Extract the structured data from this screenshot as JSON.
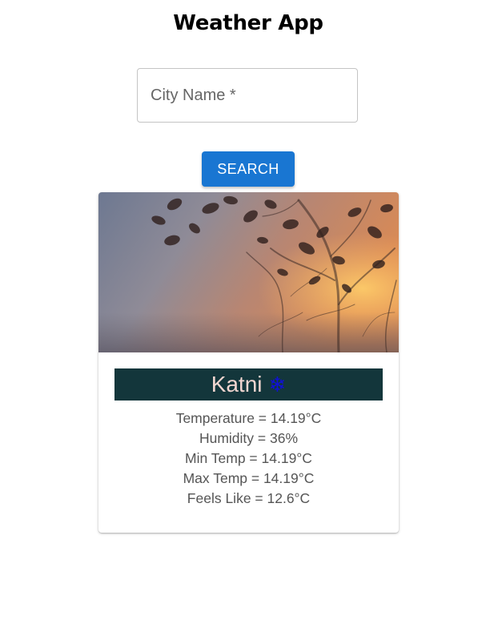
{
  "app": {
    "title": "Weather App"
  },
  "search": {
    "placeholder": "City Name *",
    "button_label": "SEARCH"
  },
  "card": {
    "image": "foggy-tree-night-photo",
    "city": "Katni",
    "condition_icon": "snowflake-icon",
    "condition_glyph": "❄",
    "stats": [
      "Temperature = 14.19°C",
      "Humidity = 36%",
      "Min Temp = 14.19°C",
      "Max Temp = 14.19°C",
      "Feels Like = 12.6°C"
    ]
  },
  "colors": {
    "accent": "#1976d2",
    "city_bar": "#13363b",
    "city_text": "#f2d6d0",
    "icon": "#1010d8"
  }
}
